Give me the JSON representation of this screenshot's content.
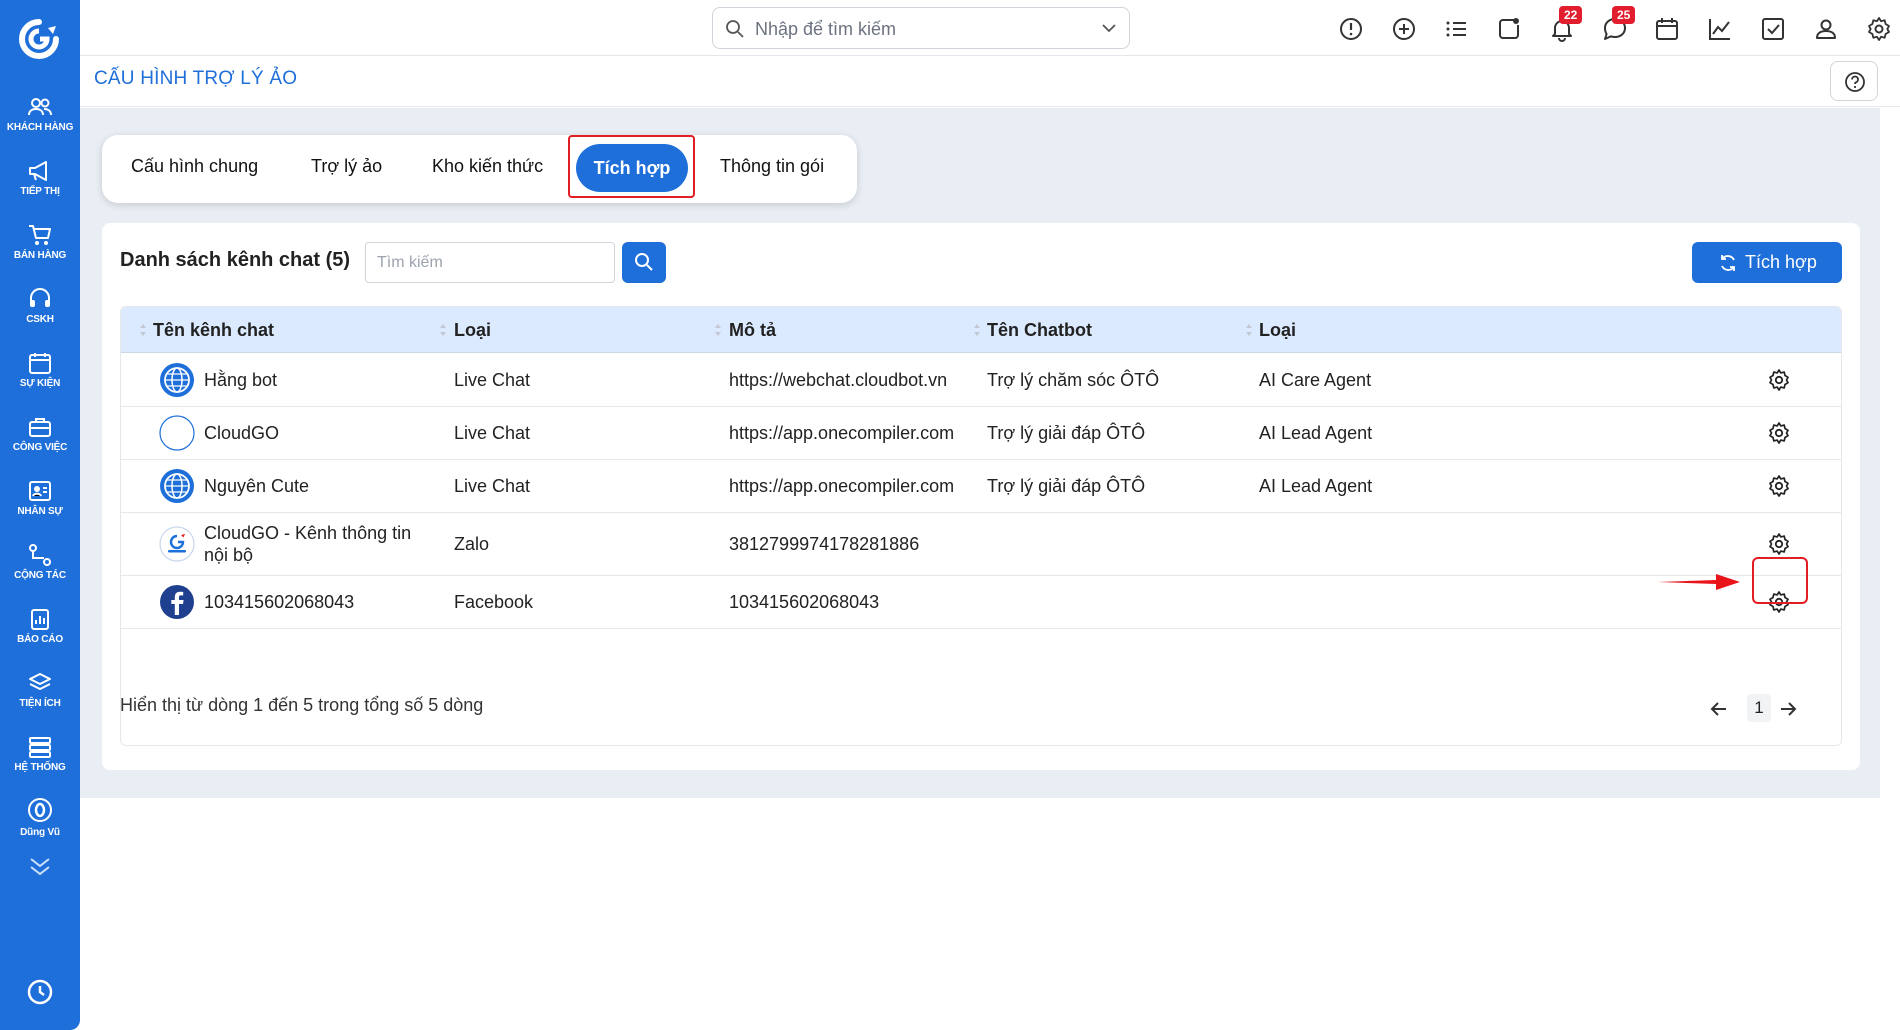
{
  "sidebar": {
    "items": [
      {
        "label": "KHÁCH HÀNG",
        "icon": "users-icon"
      },
      {
        "label": "TIẾP THỊ",
        "icon": "megaphone-icon"
      },
      {
        "label": "BÁN HÀNG",
        "icon": "cart-icon"
      },
      {
        "label": "CSKH",
        "icon": "headset-icon"
      },
      {
        "label": "SỰ KIỆN",
        "icon": "calendar-icon"
      },
      {
        "label": "CÔNG VIỆC",
        "icon": "briefcase-icon"
      },
      {
        "label": "NHÂN SỰ",
        "icon": "id-card-icon"
      },
      {
        "label": "CỘNG TÁC",
        "icon": "share-icon"
      },
      {
        "label": "BÁO CÁO",
        "icon": "clipboard-icon"
      },
      {
        "label": "TIỆN ÍCH",
        "icon": "layers-icon"
      },
      {
        "label": "HỆ THỐNG",
        "icon": "server-icon"
      },
      {
        "label": "Dũng Vũ",
        "icon": "user-zero-icon"
      }
    ]
  },
  "topbar": {
    "search_placeholder": "Nhập để tìm kiếm",
    "notification_count": "22",
    "message_count": "25"
  },
  "page": {
    "title": "CẤU HÌNH TRỢ LÝ ẢO"
  },
  "tabs": [
    "Cấu hình chung",
    "Trợ lý ảo",
    "Kho kiến thức",
    "Tích hợp",
    "Thông tin gói"
  ],
  "card": {
    "title": "Danh sách kênh chat (5)",
    "search_placeholder": "Tìm kiếm",
    "integrate_label": "Tích hợp"
  },
  "table": {
    "headers": [
      "Tên kênh chat",
      "Loại",
      "Mô tả",
      "Tên Chatbot",
      "Loại"
    ],
    "rows": [
      {
        "name": "Hằng bot",
        "type": "Live Chat",
        "desc": "https://webchat.cloudbot.vn",
        "chatbot": "Trợ lý chăm sóc ÔTÔ",
        "agent": "AI Care Agent",
        "icon": "globe-icon"
      },
      {
        "name": "CloudGO",
        "type": "Live Chat",
        "desc": "https://app.onecompiler.com",
        "chatbot": "Trợ lý giải đáp ÔTÔ",
        "agent": "AI Lead Agent",
        "icon": "blank-circle-icon"
      },
      {
        "name": "Nguyên Cute",
        "type": "Live Chat",
        "desc": "https://app.onecompiler.com",
        "chatbot": "Trợ lý giải đáp ÔTÔ",
        "agent": "AI Lead Agent",
        "icon": "globe-icon"
      },
      {
        "name": "CloudGO - Kênh thông tin",
        "name2": "nội bộ",
        "type": "Zalo",
        "desc": "3812799974178281886",
        "chatbot": "",
        "agent": "",
        "icon": "cloudgo-logo-icon"
      },
      {
        "name": "103415602068043",
        "type": "Facebook",
        "desc": "103415602068043",
        "chatbot": "",
        "agent": "",
        "icon": "facebook-icon"
      }
    ],
    "footer_text": "Hiển thị từ dòng 1 đến 5 trong tổng số 5 dòng",
    "page": "1"
  },
  "colors": {
    "brand": "#1e6fd9",
    "highlight": "#e01e24",
    "header_bg": "#dbeafe"
  }
}
